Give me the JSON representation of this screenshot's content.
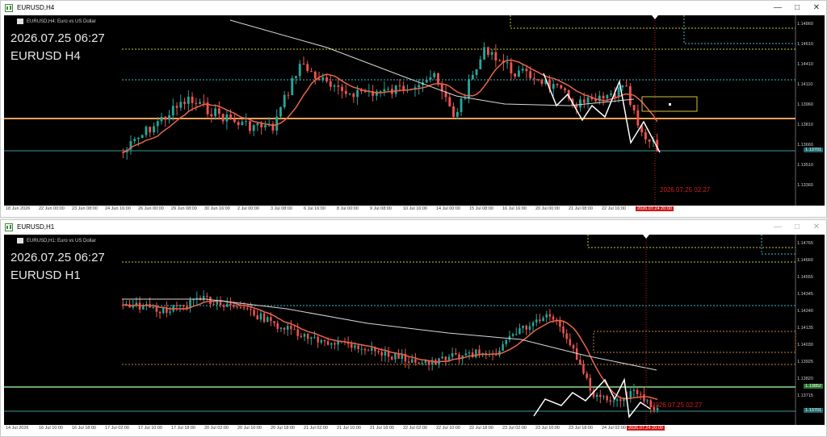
{
  "windows": [
    {
      "title": "EURUSD,H4",
      "symbol_desc": "EURUSD,H4:  Euro vs US Dollar",
      "overlay_datetime": "2026.07.25 06:27",
      "overlay_symbol": "EURUSD H4",
      "price_labels": [
        "1.14860",
        "1.14610",
        "1.14410",
        "1.14110",
        "1.13960",
        "1.13810",
        "1.13660",
        "1.13510",
        "1.13360"
      ],
      "current_price": "1.13701",
      "vline_label": "2026.07.25 02:27",
      "time_labels": [
        "18 Jun 2026",
        "22 Jun 00:00",
        "23 Jun 08:00",
        "24 Jun 16:00",
        "26 Jun 00:00",
        "29 Jun 08:00",
        "30 Jun 16:00",
        "2 Jul 00:00",
        "3 Jul 08:00",
        "6 Jul 16:00",
        "8 Jul 00:00",
        "9 Jul 08:00",
        "10 Jul 16:00",
        "14 Jul 00:00",
        "15 Jul 08:00",
        "16 Jul 16:00",
        "20 Jul 00:00",
        "21 Jul 08:00",
        "22 Jul 16:00"
      ],
      "time_tag": "2026.07.24 20:00"
    },
    {
      "title": "EURUSD,H1",
      "symbol_desc": "EURUSD,H1:  Euro vs US Dollar",
      "overlay_datetime": "2026.07.25 06:27",
      "overlay_symbol": "EURUSD H1",
      "price_labels": [
        "1.14765",
        "1.14660",
        "1.14555",
        "1.14345",
        "1.14240",
        "1.14135",
        "1.14030",
        "1.13925",
        "1.13820",
        "1.13715"
      ],
      "current_price": "1.13701",
      "green_line_price": "1.13852",
      "vline_label": "2026.07.25 02:27",
      "time_labels": [
        "14 Jul 2026",
        "16 Jul 10:00",
        "16 Jul 18:00",
        "17 Jul 02:00",
        "17 Jul 10:00",
        "17 Jul 18:00",
        "20 Jul 02:00",
        "20 Jul 10:00",
        "20 Jul 18:00",
        "21 Jul 02:00",
        "21 Jul 10:00",
        "21 Jul 18:00",
        "22 Jul 02:00",
        "22 Jul 10:00",
        "22 Jul 18:00",
        "23 Jul 02:00",
        "23 Jul 10:00",
        "23 Jul 18:00",
        "24 Jul 02:00",
        "24 Jul 10:00"
      ],
      "time_tag": "2026.07.24 20:00"
    }
  ],
  "colors": {
    "bull": "#26a69a",
    "bear": "#ef5350",
    "ma_fast": "#e8664a",
    "ma_slow": "#d8d8d8",
    "hline_orange": "#f0a060",
    "hline_teal": "#3a9a9a",
    "dotted_yellow": "#c8c830",
    "dotted_cyan": "#40b8c8",
    "vline_red": "#c02020",
    "zigzag": "#ffffff",
    "green_line": "#8ee08e"
  },
  "icons": {
    "window": "chart-window-icon",
    "minimize": "minimize-icon",
    "maximize": "maximize-icon",
    "close": "close-icon"
  }
}
